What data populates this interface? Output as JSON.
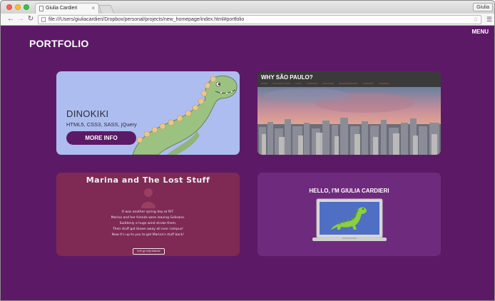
{
  "browser": {
    "tab_title": "Giulia Cardieri",
    "tab_close": "×",
    "profile_name": "Giulia",
    "url": "file:///Users/giuliacardieri/Dropbox/personal/projects/new_homepage/index.html#portfolio",
    "icons": [
      "back-arrow-icon",
      "forward-arrow-icon",
      "reload-icon",
      "file-icon",
      "bookmark-star-icon",
      "hamburger-menu-icon"
    ]
  },
  "site": {
    "logo": "PORTFOLIO",
    "menu": "MENU",
    "colors": {
      "background": "#5c1a66",
      "accent": "#5c1a66"
    }
  },
  "projects": {
    "dinokiki": {
      "title": "DINOKIKI",
      "tech": "HTML5, CSS3, SASS, jQuery",
      "button": "MORE INFO"
    },
    "sao_paulo": {
      "title": "WHY SÃO PAULO?",
      "nav": [
        "HOME",
        "CULTURE & ARTS",
        "FOOD",
        "SHOPPING",
        "NIGHTLIFE",
        "NEIGHBORHOODS",
        "ECONOMY",
        "SUMMARY"
      ]
    },
    "marina": {
      "title": "Marina and The Lost Stuff",
      "lines": [
        "It was another spring day at RIT.",
        "Marina and her friends were leaving Golisano.",
        "Suddenly a huge wind stroke them.",
        "Their stuff got blown away all over campus!",
        "Now it's up to you to get Marina's stuff back!"
      ],
      "button": "Let's go help Marina!!"
    },
    "hello": {
      "title": "HELLO, I'M GIULIA CARDIERI"
    }
  }
}
